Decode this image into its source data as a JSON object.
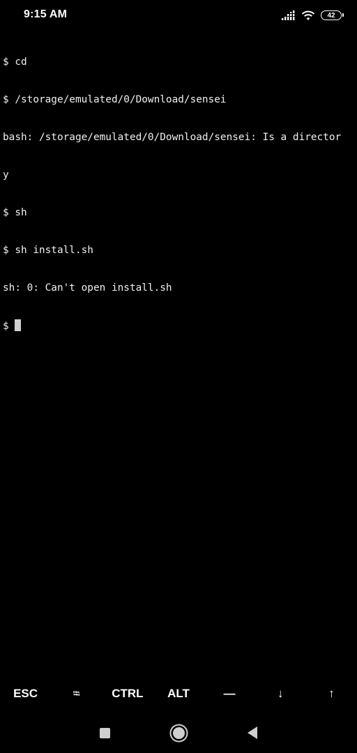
{
  "status_bar": {
    "time": "9:15 AM",
    "battery_level": "42",
    "icons": [
      "signal-icon",
      "wifi-icon",
      "battery-icon"
    ]
  },
  "terminal": {
    "lines": [
      "$ cd",
      "$ /storage/emulated/0/Download/sensei",
      "bash: /storage/emulated/0/Download/sensei: Is a director",
      "y",
      "$ sh",
      "$ sh install.sh",
      "sh: 0: Can't open install.sh",
      "$ "
    ],
    "cursor_color": "#d0d0d0",
    "text_color": "#f0f0f0",
    "background_color": "#000000"
  },
  "extra_keys": {
    "esc": "ESC",
    "tab": "⭾",
    "ctrl": "CTRL",
    "alt": "ALT",
    "dash": "—",
    "down": "↓",
    "up": "↑"
  },
  "nav_bar": {
    "icons": [
      "recents-square-icon",
      "home-circle-icon",
      "back-triangle-icon"
    ]
  }
}
